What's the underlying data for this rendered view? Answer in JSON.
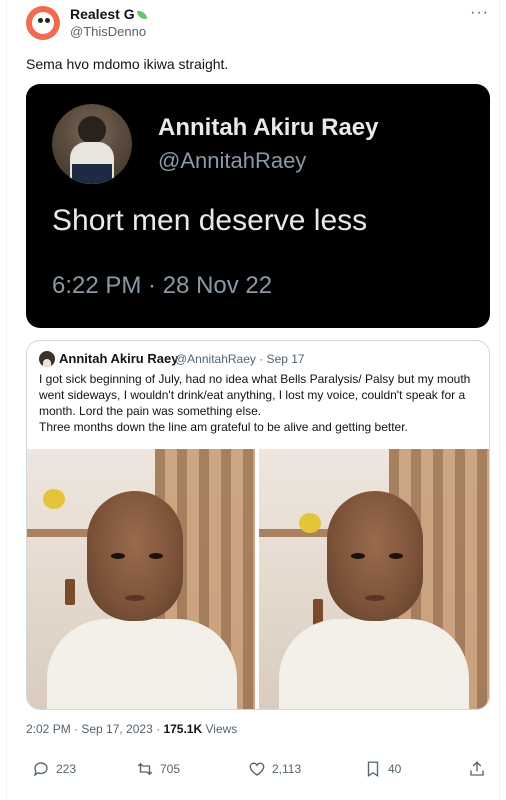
{
  "tweet": {
    "author_name": "Realest G",
    "handle": "@ThisDenno",
    "text": "Sema hvo mdomo ikiwa straight.",
    "timestamp": "2:02 PM · Sep 17, 2023",
    "views_count": "175.1K",
    "views_label": "Views"
  },
  "screenshot_card": {
    "name": "Annitah Akiru Raey",
    "handle": "@AnnitahRaey",
    "text": "Short men deserve less",
    "time": "6:22 PM · 28 Nov 22"
  },
  "quoted": {
    "name": "Annitah Akiru Raey",
    "meta": "@AnnitahRaey · Sep 17",
    "paragraph_1": "I got sick beginning of July, had no idea what Bells Paralysis/ Palsy but my mouth went sideways, I wouldn't drink/eat anything, I lost my voice, couldn't speak for a month. Lord the pain was something else.",
    "paragraph_2": "Three months down the line am grateful to be alive and getting better."
  },
  "actions": {
    "replies": "223",
    "retweets": "705",
    "likes": "2,113",
    "bookmarks": "40"
  },
  "icons": {
    "more": "more-icon",
    "reply": "reply-icon",
    "retweet": "retweet-icon",
    "like": "heart-icon",
    "bookmark": "bookmark-icon",
    "share": "share-icon"
  },
  "colors": {
    "text_primary": "#0f1419",
    "text_secondary": "#536471",
    "card_dark": "#000000",
    "border": "#cfd9de"
  }
}
